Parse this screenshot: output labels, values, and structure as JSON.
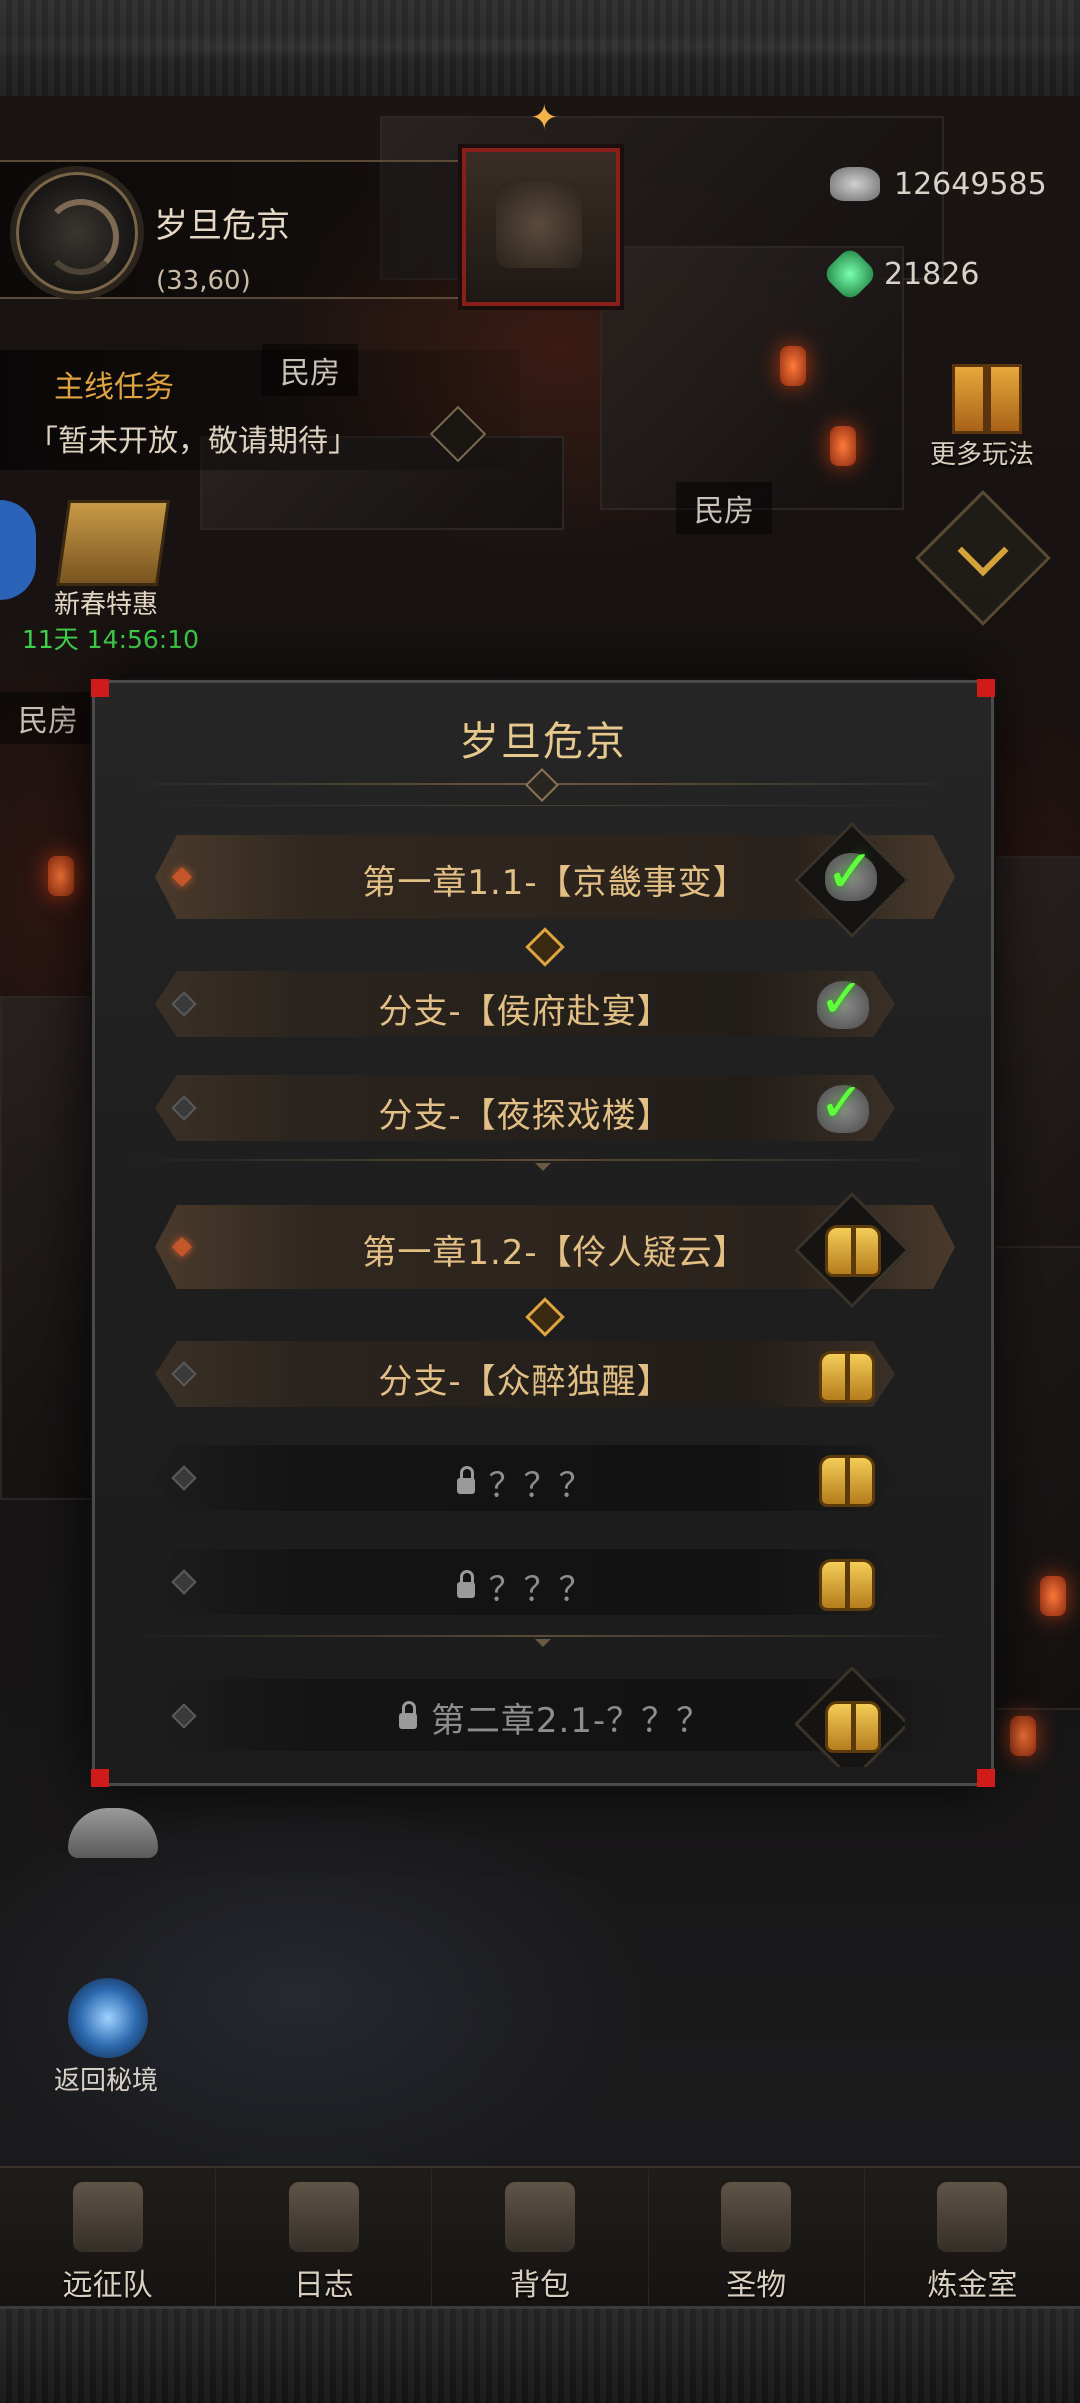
{
  "location": {
    "name": "岁旦危京",
    "coords": "(33,60)"
  },
  "resources": [
    {
      "icon": "silver-ingot-icon",
      "value": "12649585"
    },
    {
      "icon": "jade-gem-icon",
      "value": "21826"
    }
  ],
  "quest": {
    "title": "主线任务",
    "text": "「暂未开放，敬请期待」"
  },
  "map_labels": {
    "house_1": "民房",
    "house_2": "民房",
    "house_3": "民房"
  },
  "side": {
    "more_label": "更多玩法"
  },
  "event": {
    "name": "新春特惠",
    "timer": "11天 14:56:10"
  },
  "panel": {
    "title": "岁旦危京",
    "entries": [
      {
        "text": "第一章1.1-【京畿事变】",
        "kind": "chapter",
        "status": "completed"
      },
      {
        "text": "分支-【侯府赴宴】",
        "kind": "branch",
        "status": "completed"
      },
      {
        "text": "分支-【夜探戏楼】",
        "kind": "branch",
        "status": "completed"
      },
      {
        "text": "第一章1.2-【伶人疑云】",
        "kind": "chapter",
        "status": "available"
      },
      {
        "text": "分支-【众醉独醒】",
        "kind": "branch",
        "status": "available"
      },
      {
        "text": "？？？",
        "kind": "branch",
        "status": "locked"
      },
      {
        "text": "？？？",
        "kind": "branch",
        "status": "locked"
      },
      {
        "text": "第二章2.1-？？？",
        "kind": "chapter",
        "status": "locked"
      }
    ]
  },
  "portal": {
    "label": "返回秘境"
  },
  "nav": [
    {
      "label": "远征队",
      "icon": "helmet-icon"
    },
    {
      "label": "日志",
      "icon": "scroll-icon"
    },
    {
      "label": "背包",
      "icon": "backpack-icon"
    },
    {
      "label": "圣物",
      "icon": "chalice-icon"
    },
    {
      "label": "炼金室",
      "icon": "alchemy-icon"
    }
  ],
  "colors": {
    "gold_text": "#e2bf85",
    "title_gold": "#e7c98e",
    "check_green": "#5cff3a",
    "timer_green": "#3fd24a",
    "accent_red": "#d11a1a"
  }
}
